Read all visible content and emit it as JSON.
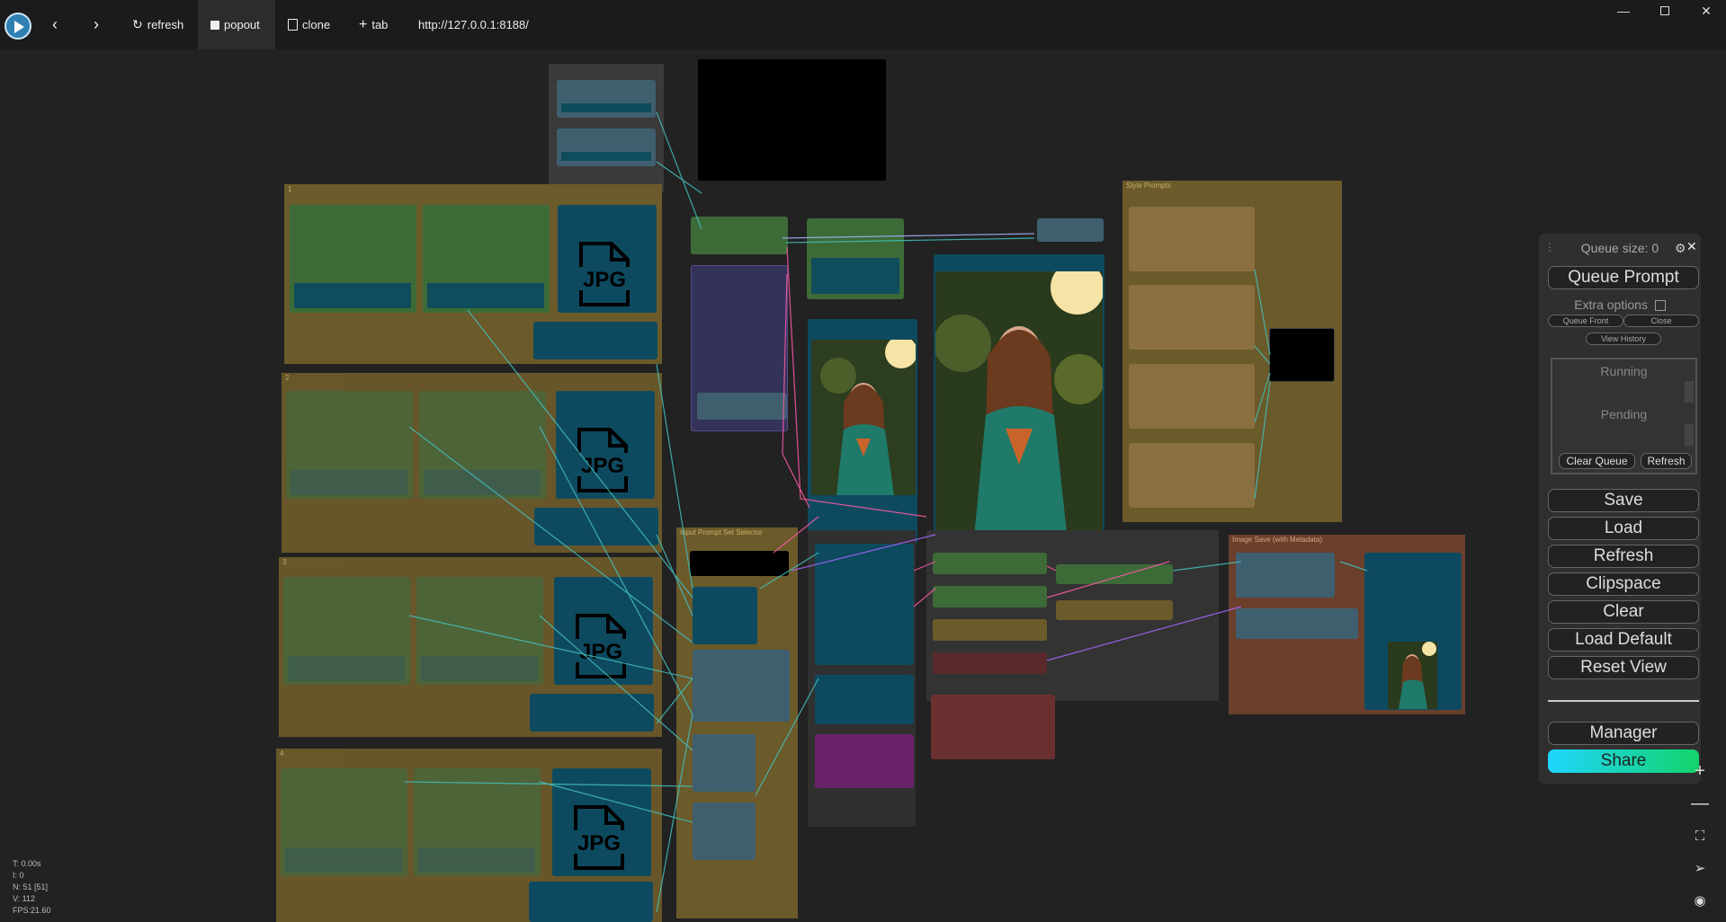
{
  "toolbar": {
    "back_icon": "chevron-left-icon",
    "forward_icon": "chevron-right-icon",
    "refresh_label": "refresh",
    "popout_label": "popout",
    "clone_label": "clone",
    "tab_label": "tab",
    "url": "http://127.0.0.1:8188/"
  },
  "window_controls": [
    "minimize-icon",
    "restore-icon",
    "close-icon"
  ],
  "canvas": {
    "groups": [
      {
        "title": "1"
      },
      {
        "title": "2"
      },
      {
        "title": "3"
      },
      {
        "title": "4"
      },
      {
        "title": "Style Prompts"
      },
      {
        "title": "Input Prompt Set Selector"
      },
      {
        "title": "Image Save (with Metadata)"
      }
    ],
    "jpg_label": "JPG"
  },
  "queue_panel": {
    "title": "Queue size: 0",
    "queue_prompt": "Queue Prompt",
    "extra_options": "Extra options",
    "queue_front": "Queue Front",
    "close": "Close",
    "view_history": "View History",
    "running": "Running",
    "pending": "Pending",
    "clear_queue": "Clear Queue",
    "refresh_small": "Refresh",
    "save": "Save",
    "load": "Load",
    "refresh": "Refresh",
    "clipspace": "Clipspace",
    "clear": "Clear",
    "load_default": "Load Default",
    "reset_view": "Reset View",
    "manager": "Manager",
    "share": "Share"
  },
  "zoom_controls": [
    "zoom-in-icon",
    "zoom-out-icon",
    "fit-view-icon",
    "send-icon",
    "eye-icon"
  ],
  "stats": {
    "t": "T: 0.00s",
    "i": "I: 0",
    "n": "N: 51 [51]",
    "v": "V: 112",
    "fps": "FPS:21.60"
  },
  "colors": {
    "canvas_bg": "#222222",
    "group_olive": "#6b5a2a",
    "node_green": "#3d6b38",
    "node_teal": "#0e4a5f",
    "share_gradient_start": "#1fd5ff",
    "share_gradient_end": "#13d46a"
  }
}
